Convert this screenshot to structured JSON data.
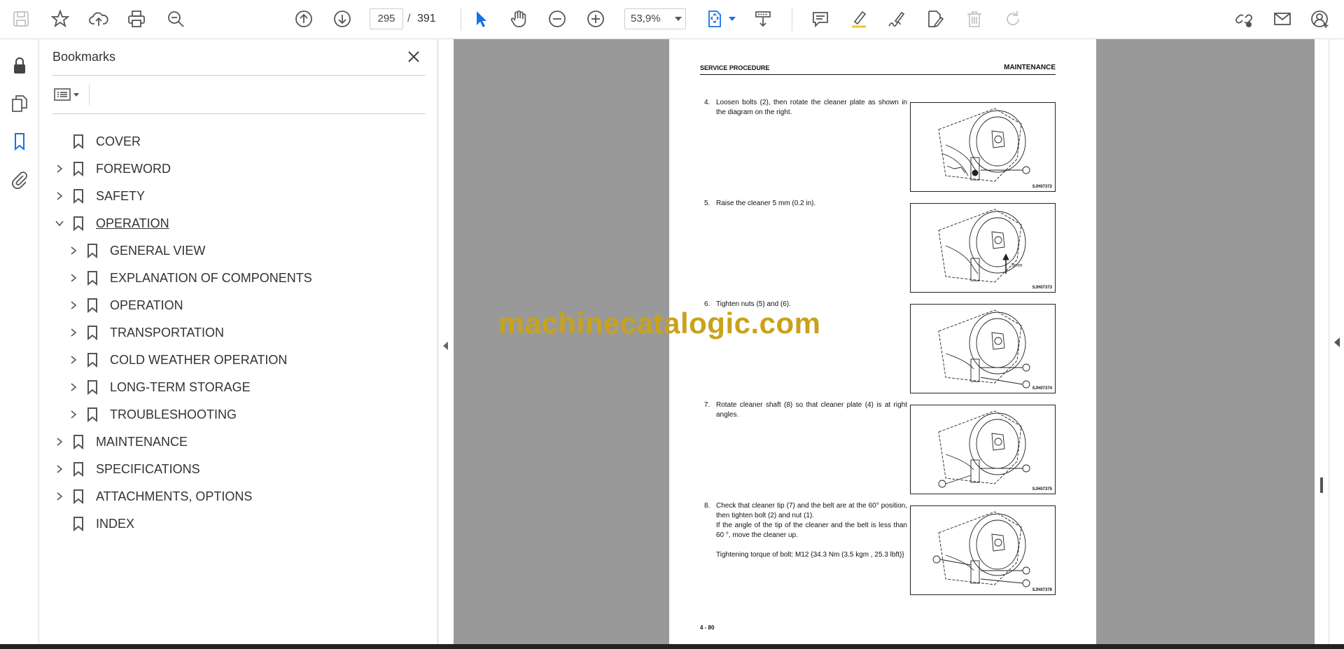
{
  "toolbar": {
    "current_page": "295",
    "page_separator": "/",
    "total_pages": "391",
    "zoom": "53,9%"
  },
  "bookmarks_panel": {
    "title": "Bookmarks",
    "items": [
      {
        "label": "COVER",
        "level": 0,
        "expandable": false
      },
      {
        "label": "FOREWORD",
        "level": 0,
        "expandable": true
      },
      {
        "label": "SAFETY",
        "level": 0,
        "expandable": true
      },
      {
        "label": "OPERATION",
        "level": 0,
        "expandable": true,
        "expanded": true
      },
      {
        "label": "GENERAL VIEW",
        "level": 1,
        "expandable": true
      },
      {
        "label": "EXPLANATION OF COMPONENTS",
        "level": 1,
        "expandable": true
      },
      {
        "label": "OPERATION",
        "level": 1,
        "expandable": true
      },
      {
        "label": "TRANSPORTATION",
        "level": 1,
        "expandable": true
      },
      {
        "label": "COLD WEATHER OPERATION",
        "level": 1,
        "expandable": true
      },
      {
        "label": "LONG-TERM STORAGE",
        "level": 1,
        "expandable": true
      },
      {
        "label": "TROUBLESHOOTING",
        "level": 1,
        "expandable": true
      },
      {
        "label": "MAINTENANCE",
        "level": 0,
        "expandable": true
      },
      {
        "label": "SPECIFICATIONS",
        "level": 0,
        "expandable": true
      },
      {
        "label": "ATTACHMENTS, OPTIONS",
        "level": 0,
        "expandable": true
      },
      {
        "label": "INDEX",
        "level": 0,
        "expandable": false
      }
    ]
  },
  "document": {
    "header_left": "SERVICE PROCEDURE",
    "header_right": "MAINTENANCE",
    "steps": [
      {
        "num": "4.",
        "lines": [
          "Loosen bolts (2), then rotate the cleaner plate as shown in the diagram on the right."
        ],
        "figure_id": "SJH07372"
      },
      {
        "num": "5.",
        "lines": [
          "Raise the cleaner 5 mm (0.2 in)."
        ],
        "figure_id": "SJH07373"
      },
      {
        "num": "6.",
        "lines": [
          "Tighten nuts (5) and (6)."
        ],
        "figure_id": "SJH07374"
      },
      {
        "num": "7.",
        "lines": [
          "Rotate cleaner shaft (8) so that cleaner plate (4) is at right angles."
        ],
        "figure_id": "SJH07375"
      },
      {
        "num": "8.",
        "lines": [
          "Check that cleaner tip (7) and the belt are at the 60° position, then tighten bolt (2) and nut (1).",
          "If the angle of the tip of the cleaner and the belt is less than 60 °, move the cleaner up.",
          "",
          "Tightening torque of bolt: M12 {34.3 Nm (3.5 kgm , 25.3 lbft)}"
        ],
        "figure_id": "SJH07376"
      }
    ],
    "page_number": "4 - 80"
  },
  "watermark": "machinecatalogic.com",
  "colors": {
    "accent": "#1473e6",
    "doc_background": "#999999",
    "watermark": "#c9a21c"
  }
}
